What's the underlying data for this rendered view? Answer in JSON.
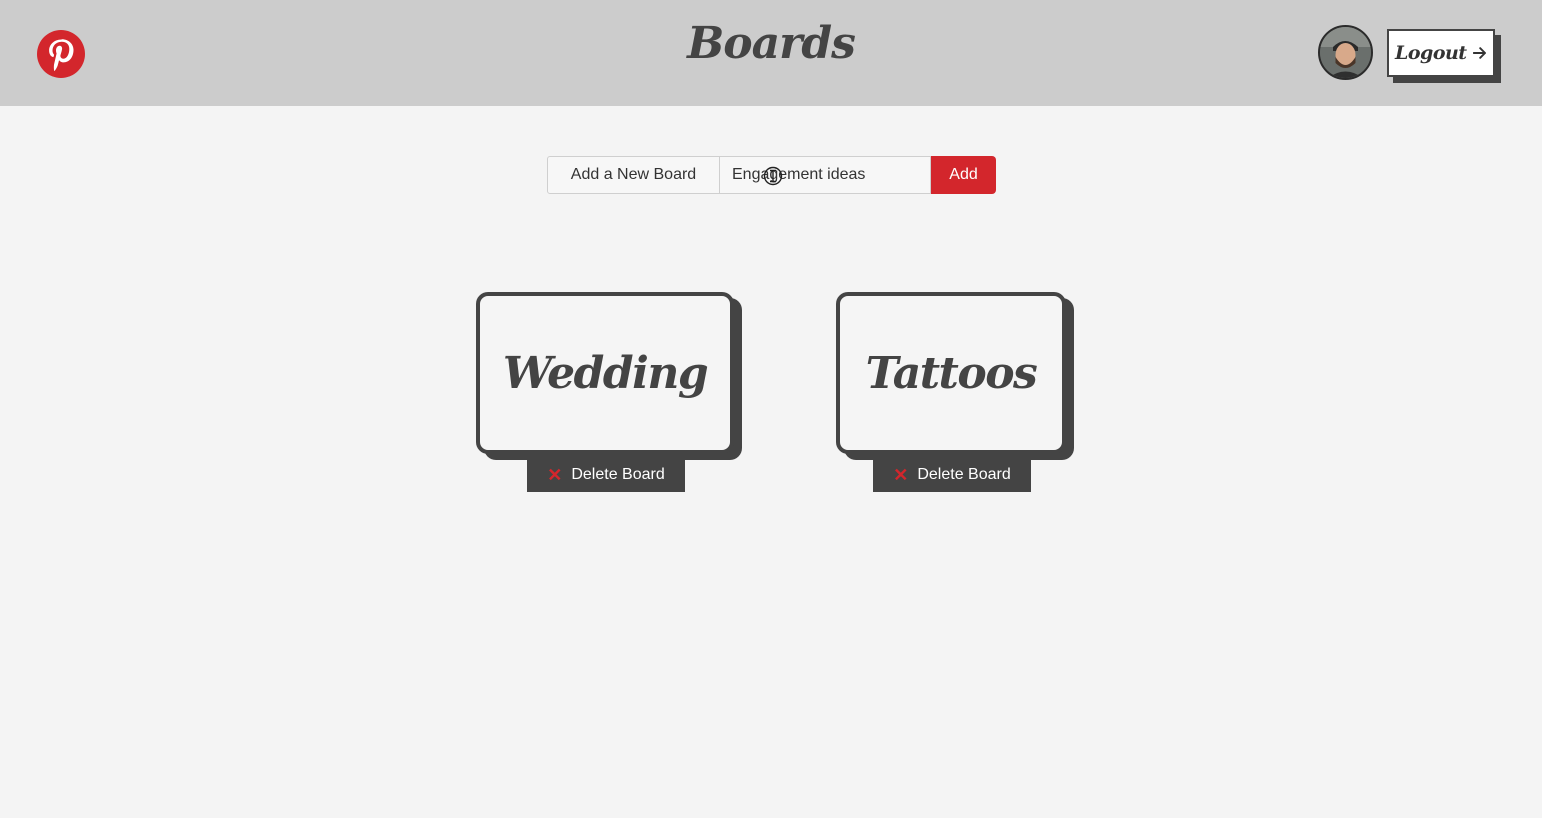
{
  "header": {
    "title": "Boards",
    "logout_label": "Logout",
    "logo_icon": "pinterest-logo-icon",
    "arrow_icon": "arrow-right-icon",
    "brand_color": "#d3262c"
  },
  "add_board": {
    "label": "Add a New Board",
    "input_value": "Engagement ideas",
    "add_label": "Add"
  },
  "boards": [
    {
      "name": "Wedding",
      "delete_label": "Delete Board"
    },
    {
      "name": "Tattoos",
      "delete_label": "Delete Board"
    }
  ]
}
